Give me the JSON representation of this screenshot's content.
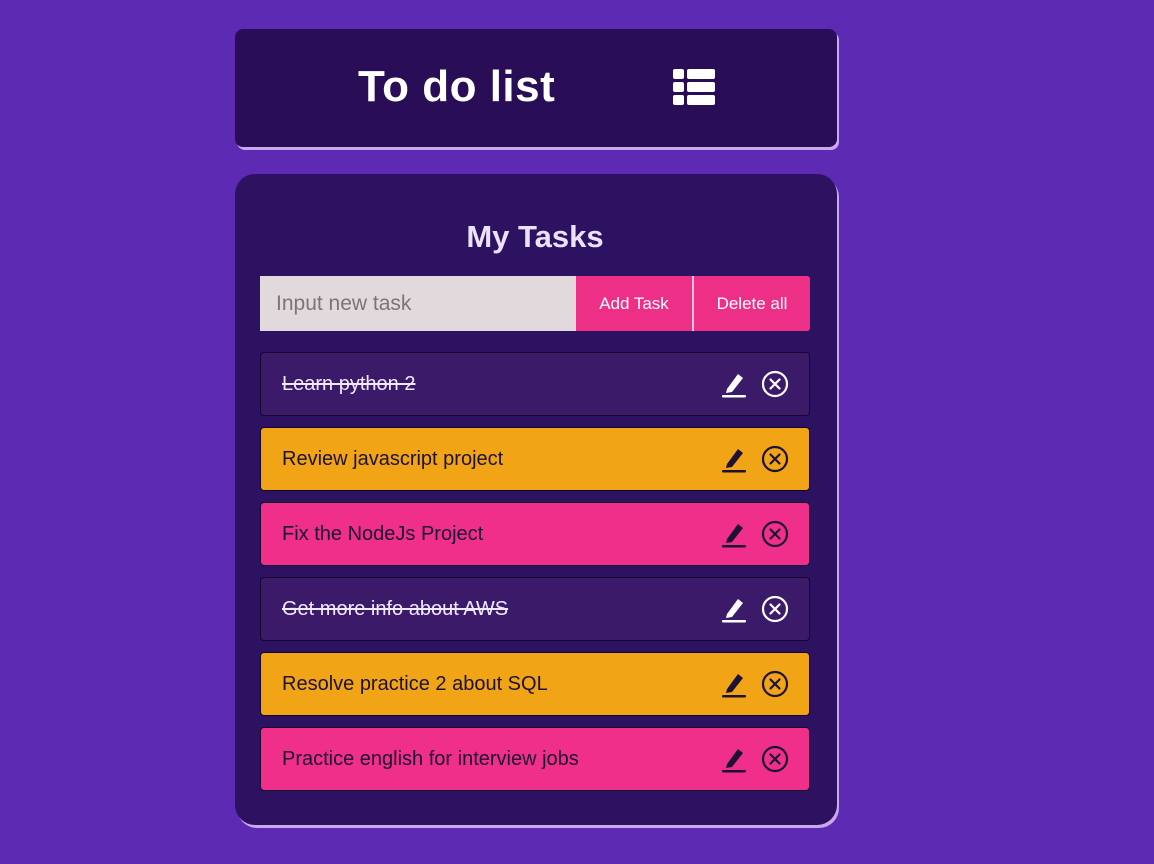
{
  "header": {
    "title": "To do list",
    "icon": "list-icon"
  },
  "panel": {
    "heading": "My Tasks",
    "input": {
      "placeholder": "Input new task",
      "value": ""
    },
    "add_label": "Add Task",
    "delete_all_label": "Delete all"
  },
  "tasks": [
    {
      "text": "Learn python 2",
      "completed": true,
      "color": "#3a1a69"
    },
    {
      "text": "Review javascript project",
      "completed": false,
      "color": "#f0a416"
    },
    {
      "text": "Fix the NodeJs Project",
      "completed": false,
      "color": "#ef2f8a"
    },
    {
      "text": "Get more info about AWS",
      "completed": true,
      "color": "#3a1a69"
    },
    {
      "text": "Resolve practice 2 about SQL",
      "completed": false,
      "color": "#f0a416"
    },
    {
      "text": "Practice english for interview jobs",
      "completed": false,
      "color": "#ef2f8a"
    }
  ],
  "colors": {
    "background": "#5d2ab3",
    "header": "#290e57",
    "panel": "#2d1261",
    "accent_pink": "#ee2f87",
    "accent_orange": "#f0a416"
  },
  "icons": {
    "edit": "pencil-icon",
    "delete": "circle-x-icon"
  }
}
